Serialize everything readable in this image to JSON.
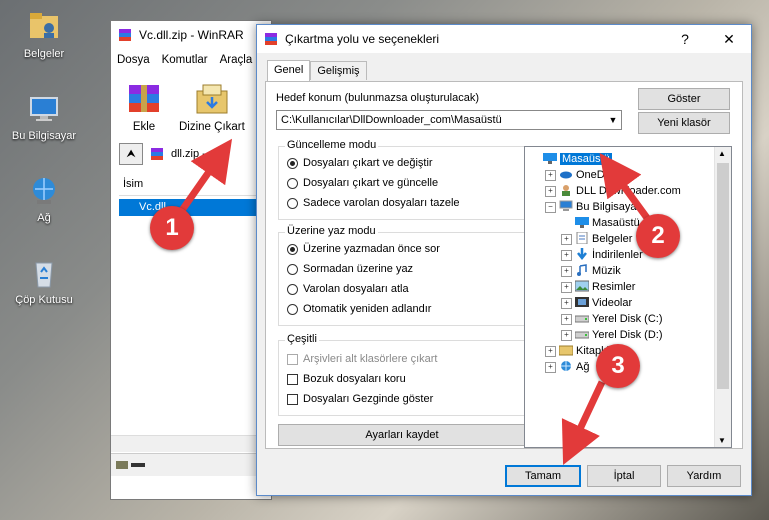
{
  "desktop": {
    "icons": [
      {
        "label": "Belgeler",
        "icon": "documents-folder-icon"
      },
      {
        "label": "Bu Bilgisayar",
        "icon": "computer-icon"
      },
      {
        "label": "Ağ",
        "icon": "network-icon"
      },
      {
        "label": "Çöp Kutusu",
        "icon": "recycle-bin-icon"
      }
    ]
  },
  "winrar": {
    "title": "Vc.dll.zip - WinRAR",
    "menu": [
      "Dosya",
      "Komutlar",
      "Araçla"
    ],
    "toolbar": {
      "add_label": "Ekle",
      "extract_label": "Dizine Çıkart"
    },
    "address": "dll.zip -",
    "list_header": "İsim",
    "list_items": [
      "Vc.dll"
    ]
  },
  "dialog": {
    "title": "Çıkartma yolu ve seçenekleri",
    "help_symbol": "?",
    "close_symbol": "✕",
    "tabs": [
      "Genel",
      "Gelişmiş"
    ],
    "dest_label": "Hedef konum (bulunmazsa oluşturulacak)",
    "dest_value": "C:\\Kullanıcılar\\DllDownloader_com\\Masaüstü",
    "show_button": "Göster",
    "new_folder_button": "Yeni klasör",
    "update_mode": {
      "title": "Güncelleme modu",
      "options": [
        "Dosyaları çıkart ve değiştir",
        "Dosyaları çıkart ve güncelle",
        "Sadece varolan dosyaları tazele"
      ],
      "selected": 0
    },
    "overwrite_mode": {
      "title": "Üzerine yaz modu",
      "options": [
        "Üzerine yazmadan önce sor",
        "Sormadan üzerine yaz",
        "Varolan dosyaları atla",
        "Otomatik yeniden adlandır"
      ],
      "selected": 0
    },
    "misc": {
      "title": "Çeşitli",
      "options": [
        "Arşivleri alt klasörlere çıkart",
        "Bozuk dosyaları koru",
        "Dosyaları Gezginde göster"
      ],
      "disabled": [
        true,
        false,
        false
      ]
    },
    "save_settings_button": "Ayarları kaydet",
    "tree": [
      {
        "label": "Masaüstü",
        "level": 0,
        "selected": true,
        "expander": "",
        "icon": "desktop-icon"
      },
      {
        "label": "OneDrive",
        "level": 1,
        "expander": "+",
        "icon": "cloud-icon"
      },
      {
        "label": "DLL Downloader.com",
        "level": 1,
        "expander": "+",
        "icon": "user-icon"
      },
      {
        "label": "Bu Bilgisayar",
        "level": 1,
        "expander": "−",
        "icon": "computer-icon"
      },
      {
        "label": "Masaüstü",
        "level": 2,
        "expander": "",
        "icon": "desktop-icon"
      },
      {
        "label": "Belgeler",
        "level": 2,
        "expander": "+",
        "icon": "documents-icon"
      },
      {
        "label": "İndirilenler",
        "level": 2,
        "expander": "+",
        "icon": "download-icon"
      },
      {
        "label": "Müzik",
        "level": 2,
        "expander": "+",
        "icon": "music-icon"
      },
      {
        "label": "Resimler",
        "level": 2,
        "expander": "+",
        "icon": "pictures-icon"
      },
      {
        "label": "Videolar",
        "level": 2,
        "expander": "+",
        "icon": "video-icon"
      },
      {
        "label": "Yerel Disk (C:)",
        "level": 2,
        "expander": "+",
        "icon": "drive-icon"
      },
      {
        "label": "Yerel Disk (D:)",
        "level": 2,
        "expander": "+",
        "icon": "drive-icon"
      },
      {
        "label": "Kitaplıklar",
        "level": 1,
        "expander": "+",
        "icon": "library-icon"
      },
      {
        "label": "Ağ",
        "level": 1,
        "expander": "+",
        "icon": "network-icon"
      }
    ],
    "ok_button": "Tamam",
    "cancel_button": "İptal",
    "help_button": "Yardım"
  },
  "annotations": [
    "1",
    "2",
    "3"
  ],
  "colors": {
    "annotation": "#e23a3a",
    "selection": "#0078d7"
  }
}
